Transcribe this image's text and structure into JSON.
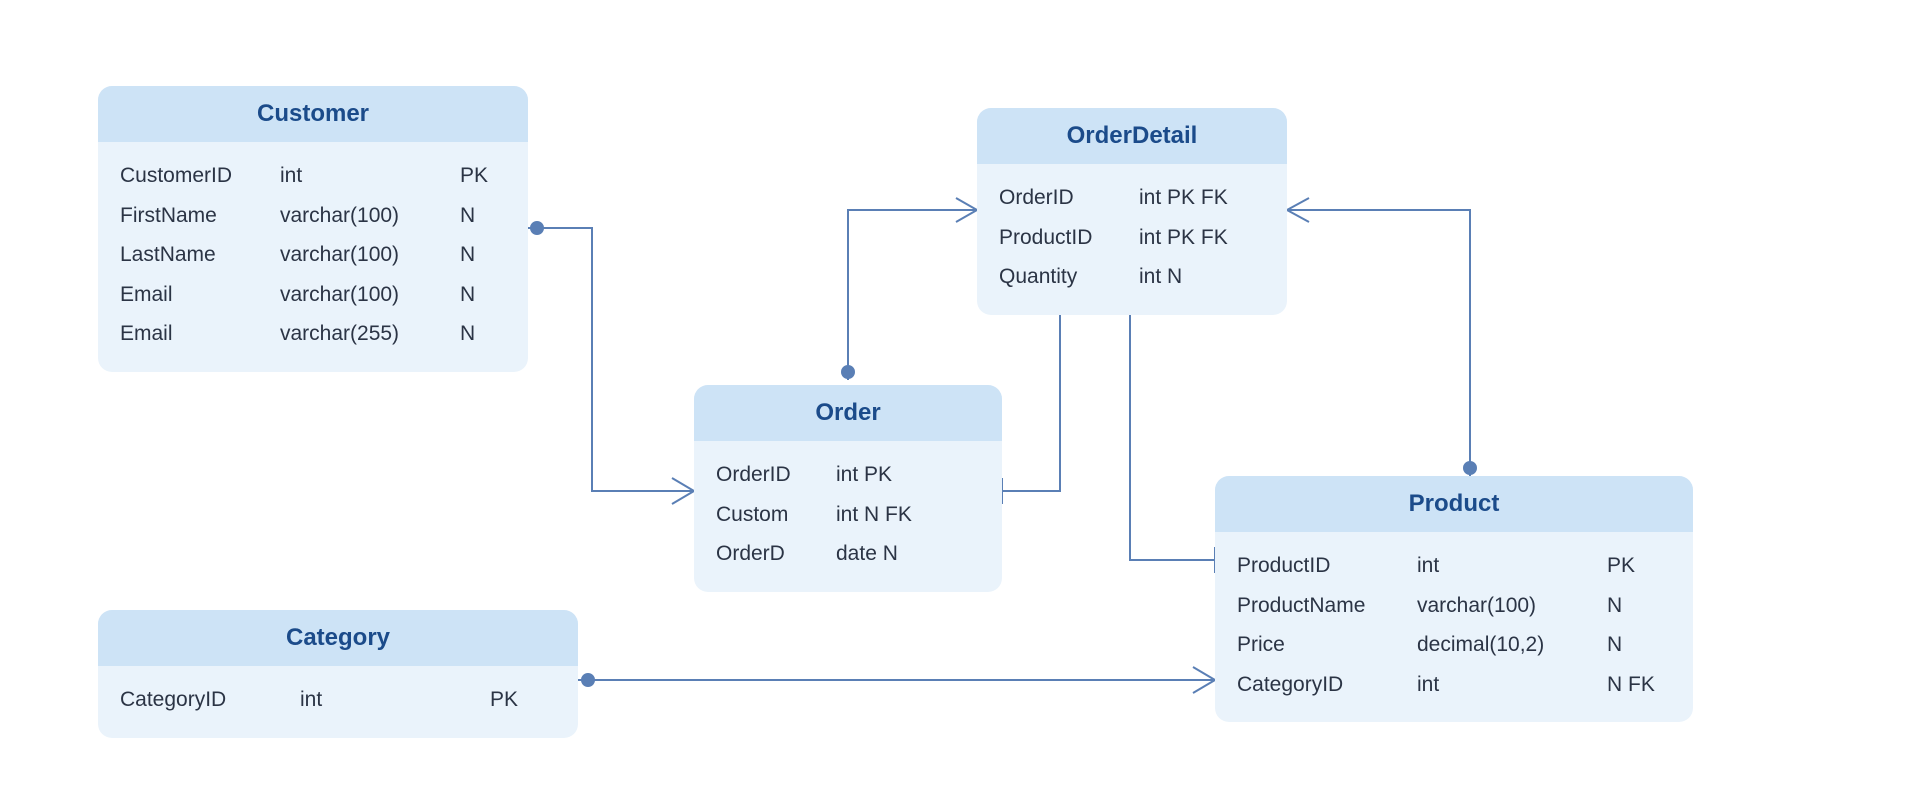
{
  "colors": {
    "line": "#5a7fb5",
    "entity_header_bg": "#cde3f6",
    "entity_body_bg": "#eaf3fb",
    "title_text": "#1b4b8a",
    "body_text": "#2b3445"
  },
  "entities": {
    "customer": {
      "title": "Customer",
      "rows": [
        {
          "name": "CustomerID",
          "type": "int",
          "flags": "PK"
        },
        {
          "name": "FirstName",
          "type": "varchar(100)",
          "flags": "N"
        },
        {
          "name": "LastName",
          "type": "varchar(100)",
          "flags": "N"
        },
        {
          "name": "Email",
          "type": "varchar(100)",
          "flags": "N"
        },
        {
          "name": "Email",
          "type": "varchar(255)",
          "flags": "N"
        }
      ]
    },
    "order": {
      "title": "Order",
      "rows": [
        {
          "name": "OrderID",
          "type": "int PK"
        },
        {
          "name": "Custom",
          "type": "int N FK"
        },
        {
          "name": "OrderD",
          "type": "date N"
        }
      ]
    },
    "orderdetail": {
      "title": "OrderDetail",
      "rows": [
        {
          "name": "OrderID",
          "type": "int PK FK"
        },
        {
          "name": "ProductID",
          "type": "int PK FK"
        },
        {
          "name": "Quantity",
          "type": "int N"
        }
      ]
    },
    "product": {
      "title": "Product",
      "rows": [
        {
          "name": "ProductID",
          "type": "int",
          "flags": "PK"
        },
        {
          "name": "ProductName",
          "type": "varchar(100)",
          "flags": "N"
        },
        {
          "name": "Price",
          "type": "decimal(10,2)",
          "flags": "N"
        },
        {
          "name": "CategoryID",
          "type": "int",
          "flags": "N FK"
        }
      ]
    },
    "category": {
      "title": "Category",
      "rows": [
        {
          "name": "CategoryID",
          "type": "int",
          "flags": "PK"
        }
      ]
    }
  },
  "relationships": [
    {
      "from": "Customer",
      "to": "Order",
      "notation": "one-to-many"
    },
    {
      "from": "Order",
      "to": "OrderDetail",
      "notation": "one-to-many"
    },
    {
      "from": "Product",
      "to": "OrderDetail",
      "notation": "one-to-many"
    },
    {
      "from": "Category",
      "to": "Product",
      "notation": "one-to-many"
    }
  ]
}
